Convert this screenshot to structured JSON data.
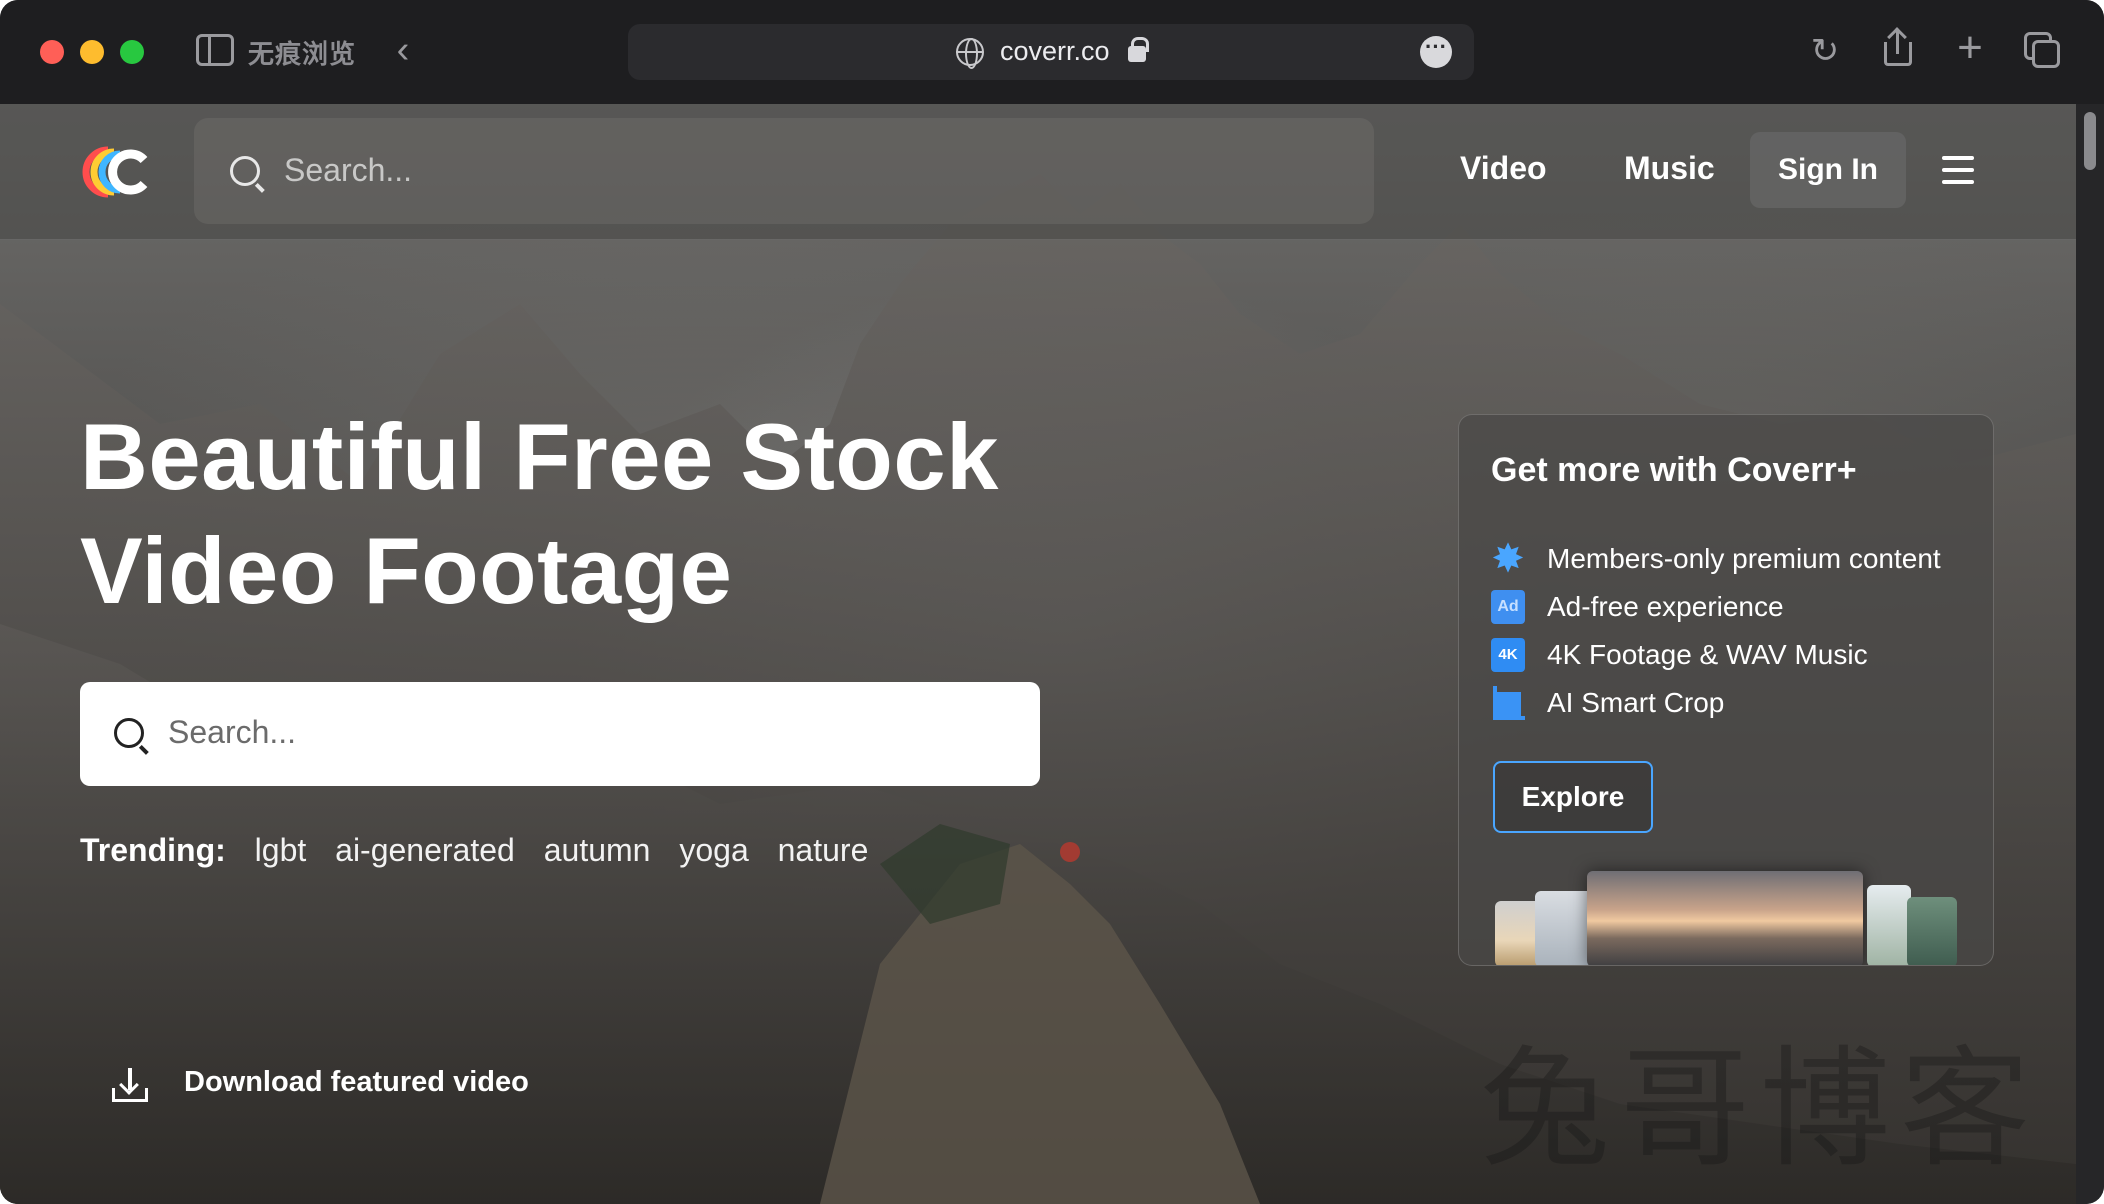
{
  "browser": {
    "window_mode_label": "无痕浏览",
    "url": "coverr.co"
  },
  "header": {
    "search_placeholder": "Search...",
    "nav": {
      "video": "Video",
      "music": "Music"
    },
    "sign_in": "Sign In"
  },
  "hero": {
    "title_line1": "Beautiful Free Stock",
    "title_line2": "Video Footage",
    "search_placeholder": "Search...",
    "trending_label": "Trending:",
    "trending_tags": [
      "lgbt",
      "ai-generated",
      "autumn",
      "yoga",
      "nature"
    ],
    "download_label": "Download featured video"
  },
  "promo": {
    "title": "Get more with Coverr+",
    "items": [
      {
        "icon": "star-badge-icon",
        "label": "Members-only premium content"
      },
      {
        "icon": "ad-free-icon",
        "label": "Ad-free experience",
        "icon_text": "Ad"
      },
      {
        "icon": "4k-icon",
        "label": "4K Footage & WAV Music",
        "icon_text": "4K"
      },
      {
        "icon": "crop-icon",
        "label": "AI Smart Crop"
      }
    ],
    "explore": "Explore"
  },
  "watermark": "兔哥博客",
  "colors": {
    "accent_blue": "#4aa6ff",
    "traffic_red": "#ff5f57",
    "traffic_yellow": "#febc2e",
    "traffic_green": "#28c840"
  }
}
